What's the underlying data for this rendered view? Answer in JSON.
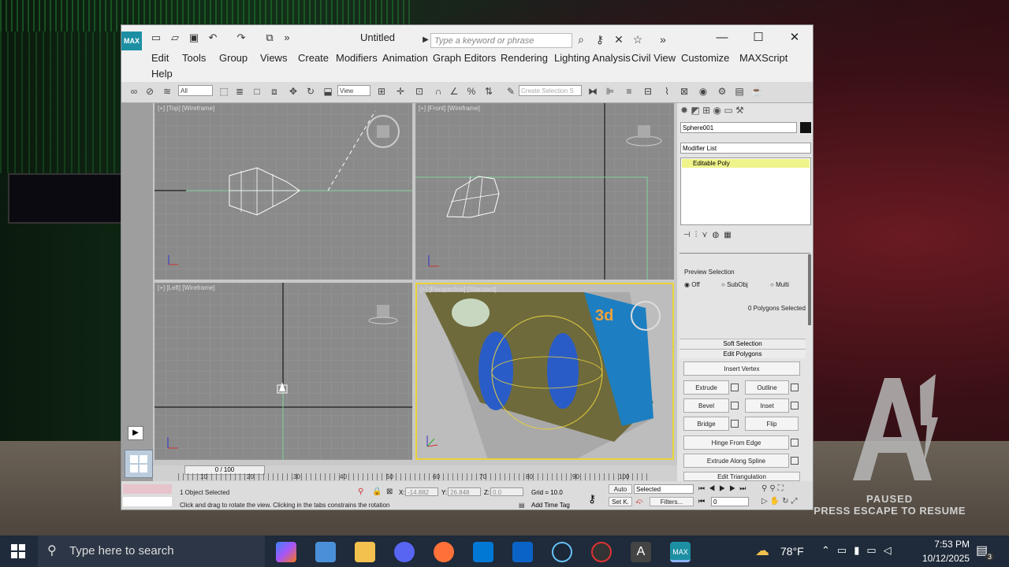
{
  "window": {
    "title": "Untitled",
    "search_placeholder": "Type a keyword or phrase",
    "logo_text": "MAX"
  },
  "menu": [
    "Edit",
    "Tools",
    "Group",
    "Views",
    "Create",
    "Modifiers",
    "Animation",
    "Graph Editors",
    "Rendering",
    "Lighting Analysis",
    "Civil View",
    "Customize",
    "MAXScript",
    "Help"
  ],
  "toolbar": {
    "selection_filter": "All",
    "ref_coord": "View",
    "named_selection": "Create Selection S"
  },
  "viewports": {
    "top": "[+] [Top] [Wireframe]",
    "front": "[+] [Front] [Wireframe]",
    "left": "[+] [Left] [Wireframe]",
    "perspective": "[+] [Perspective] [Standard]"
  },
  "command_panel": {
    "object_name": "Sphere001",
    "modifier_list": "Modifier List",
    "stack_item": "Editable Poly",
    "preview_selection_title": "Preview Selection",
    "preview_off": "Off",
    "preview_subobj": "SubObj",
    "preview_multi": "Multi",
    "polygons_selected": "0 Polygons Selected",
    "soft_selection": "Soft Selection",
    "edit_polygons": "Edit Polygons",
    "insert_vertex": "Insert Vertex",
    "extrude": "Extrude",
    "outline": "Outline",
    "bevel": "Bevel",
    "inset": "Inset",
    "bridge": "Bridge",
    "flip": "Flip",
    "hinge": "Hinge From Edge",
    "extrude_spline": "Extrude Along Spline",
    "edit_tri": "Edit Triangulation"
  },
  "timeline": {
    "frame_readout": "0 / 100",
    "ticks": [
      "10",
      "20",
      "30",
      "40",
      "50",
      "60",
      "70",
      "80",
      "90",
      "100"
    ]
  },
  "status": {
    "selected": "1 Object Selected",
    "prompt": "Click and drag to rotate the view.  Clicking in the tabs constrains the rotation",
    "x_label": "X:",
    "x_value": "-14.882",
    "y_label": "Y:",
    "y_value": "26.848",
    "z_label": "Z:",
    "z_value": "0.0",
    "grid": "Grid = 10.0",
    "add_time_tag": "Add Time Tag",
    "auto": "Auto",
    "set_key": "Set K.",
    "selected_dropdown": "Selected",
    "filters": "Filters...",
    "frame": "0"
  },
  "game_overlay": {
    "line1": "PAUSED",
    "line2": "PRESS ESCAPE TO RESUME"
  },
  "taskbar": {
    "search": "Type here to search",
    "weather": "78°F",
    "time": "7:53 PM",
    "date": "10/12/2025",
    "notifications": "3"
  }
}
